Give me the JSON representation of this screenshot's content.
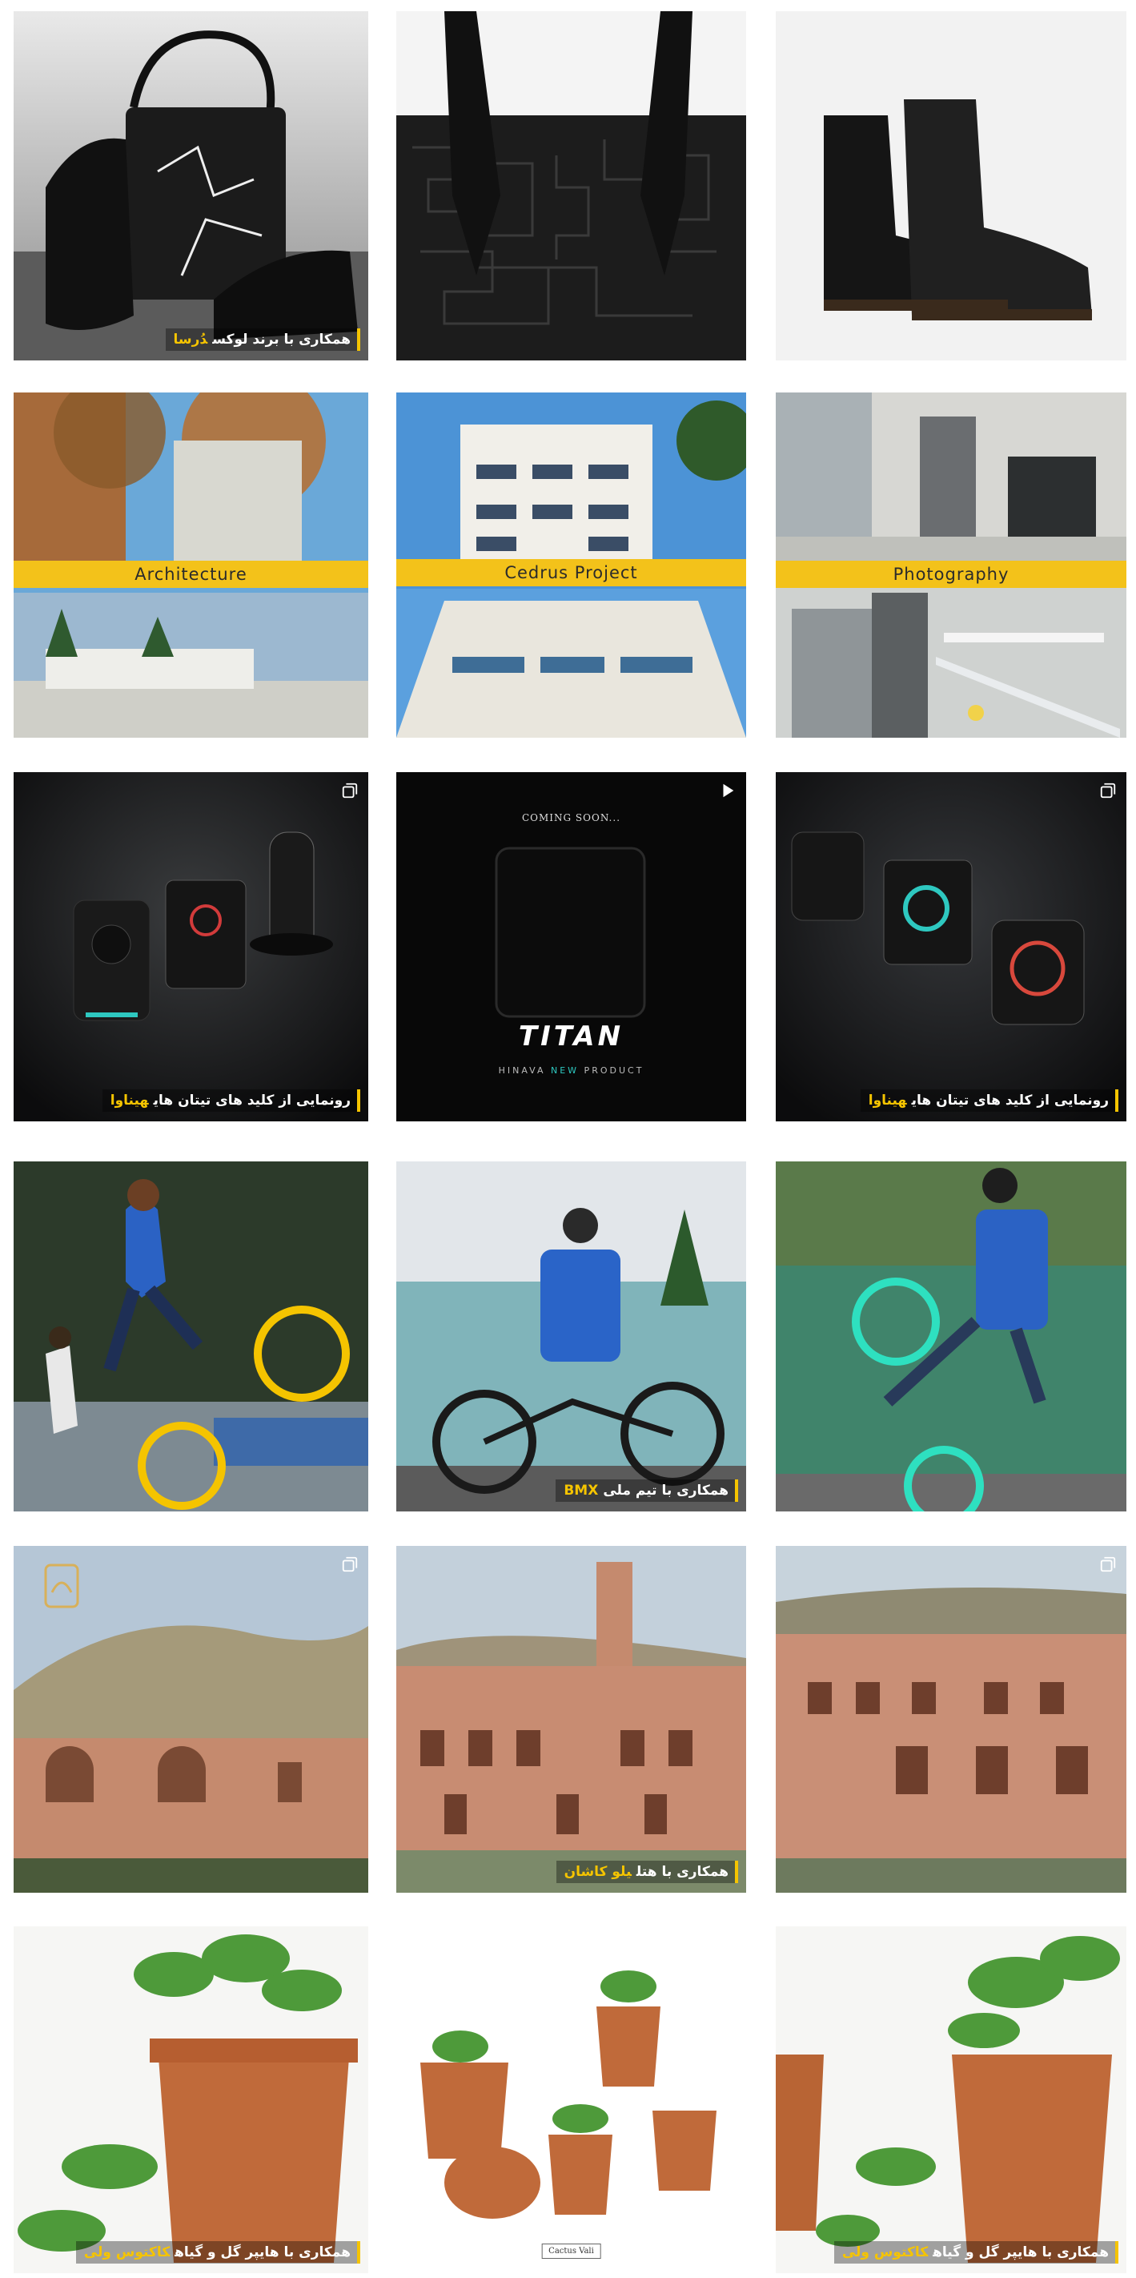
{
  "grid": {
    "tiles": [
      {
        "id": "bag",
        "caption": {
          "text": "همکاری با برند لوکس",
          "highlight": "دُرسا"
        }
      },
      {
        "id": "handbag-texture"
      },
      {
        "id": "boots"
      },
      {
        "id": "architecture",
        "band": "Architecture"
      },
      {
        "id": "cedrus",
        "band": "Cedrus Project"
      },
      {
        "id": "photography",
        "band": "Photography"
      },
      {
        "id": "switches",
        "caption": {
          "text": "رونمایی از کلید های تیتان های",
          "highlight": "هیناوا"
        }
      },
      {
        "id": "titan",
        "coming": "COMING SOON...",
        "logo": "TITAN",
        "sub_a": "HINAVA ",
        "sub_b": "NEW",
        "sub_c": " PRODUCT"
      },
      {
        "id": "thermostat",
        "caption": {
          "text": "رونمایی از کلید های تیتان های",
          "highlight": "هیناوا"
        }
      },
      {
        "id": "bmx-1"
      },
      {
        "id": "bmx-2",
        "caption": {
          "text": "همکاری با تیم ملی",
          "highlight": "BMX"
        }
      },
      {
        "id": "bmx-3"
      },
      {
        "id": "hotel-1"
      },
      {
        "id": "hotel-2",
        "caption": {
          "text": "همکاری با هتل",
          "highlight": "یلو کاشان"
        }
      },
      {
        "id": "hotel-3"
      },
      {
        "id": "plant-1",
        "caption": {
          "text": "همکاری با هایپر گل و گیاه",
          "highlight": "کاکتوس ولی"
        }
      },
      {
        "id": "plant-2",
        "logo": "Cactus Vali"
      },
      {
        "id": "plant-3",
        "caption": {
          "text": "همکاری با هایپر گل و گیاه",
          "highlight": "کاکتوس ولی"
        }
      }
    ]
  },
  "colors": {
    "accent": "#f5c400",
    "band": "#f3c21a",
    "teal": "#2ec8c0"
  },
  "icons": {
    "carousel": "stack-icon",
    "video": "play-icon"
  }
}
